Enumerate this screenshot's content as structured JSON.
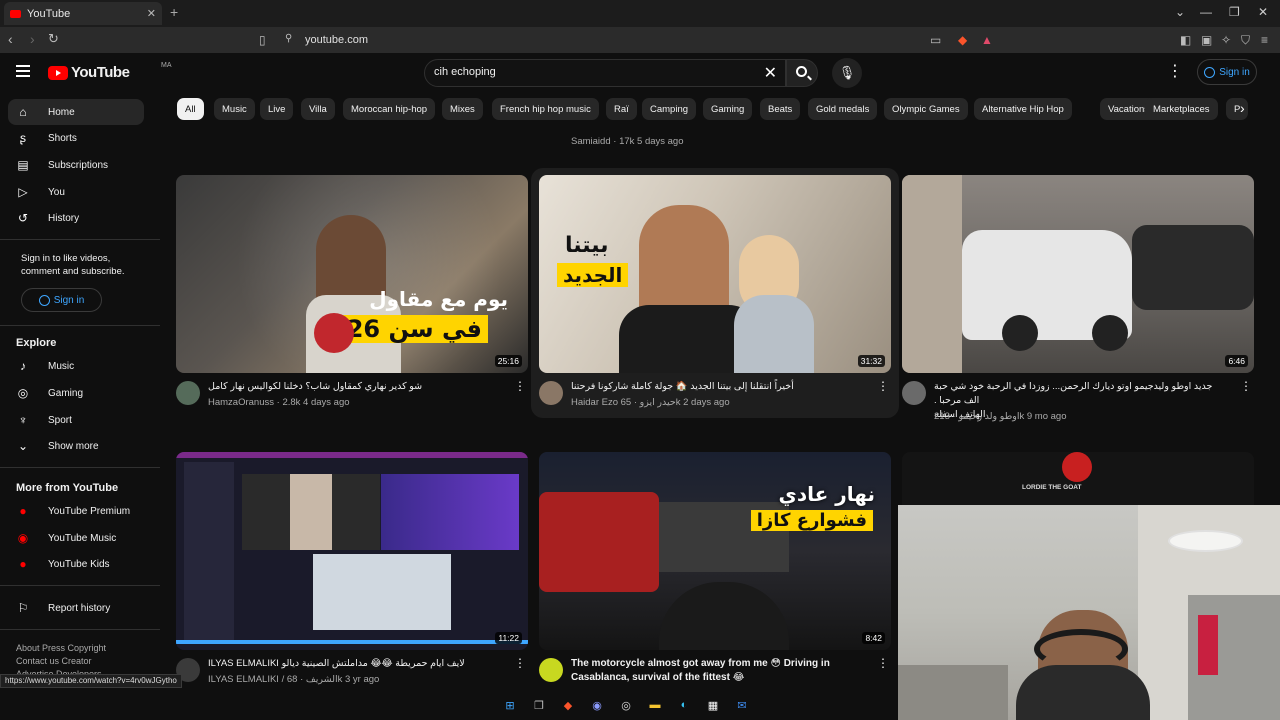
{
  "browser": {
    "tab_title": "YouTube",
    "url": "youtube.com",
    "status_url": "https://www.youtube.com/watch?v=4rv0wJGytho"
  },
  "header": {
    "logo_text": "YouTube",
    "region": "MA",
    "search_value": "cih echoping",
    "signin_label": "Sign in"
  },
  "sidebar": {
    "main": [
      "Home",
      "Shorts",
      "Subscriptions",
      "You",
      "History"
    ],
    "signin_prompt": "Sign in to like videos, comment and subscribe.",
    "signin_label": "Sign in",
    "explore_heading": "Explore",
    "explore": [
      "Music",
      "Gaming",
      "Sport",
      "Show more"
    ],
    "more_heading": "More from YouTube",
    "more": [
      "YouTube Premium",
      "YouTube Music",
      "YouTube Kids"
    ],
    "report": "Report history",
    "footer_line1": "About  Press  Copyright",
    "footer_line2": "Contact us  Creator",
    "footer_line3": "Advertise  Developers"
  },
  "chips": [
    "All",
    "Music",
    "Live",
    "Villa",
    "Moroccan hip-hop",
    "Mixes",
    "French hip hop music",
    "Raï",
    "Camping",
    "Gaming",
    "Beats",
    "Gold medals",
    "Olympic Games",
    "Alternative Hip Hop",
    "Vacations",
    "Marketplaces",
    "P"
  ],
  "top_row": {
    "middle_channel": "Samiaidd",
    "middle_meta": "17k  5 days ago"
  },
  "videos": [
    {
      "title": "شو كدير نهاري كمقاول شاب؟ دخلنا لكواليس نهار كامل",
      "channel": "HamzaOranuss",
      "meta": "2.8k  4 days ago",
      "duration": "25:16",
      "thumb_text1": "يوم مع مقاول",
      "thumb_text2": "في سن 26"
    },
    {
      "title": "أخيراً انتقلنا إلى بيتنا الجديد 🏠 جولة كاملة شاركونا فرحتنا",
      "channel": "Haidar Ezo  حيدر ايزو",
      "meta": "65k  2 days ago",
      "duration": "31:32",
      "thumb_text1": "بيتنا",
      "thumb_text2": "الجديد"
    },
    {
      "title": "جديد اوطو وليدجيمو اوتو ديارك الرحمن... زوزدا في الرحبة خود شي حبة الف مرحبا .",
      "title2": "الهاتف اسفله",
      "channel": "اوطو ولد رحيمو",
      "meta": "213k  9 mo ago",
      "duration": "6:46"
    },
    {
      "title": "ILYAS ELMALIKI  لايف ايام حمريطة 😂😂  مداملتش الصينية ديالو",
      "channel": "ILYAS ELMALIKI / الشريف",
      "meta": "68k  3 yr ago",
      "duration": "11:22"
    },
    {
      "title": "The motorcycle almost got away from me 😳 Driving in",
      "title2": "Casablanca, survival of the fittest 😂",
      "channel": "",
      "meta": "",
      "duration": "8:42",
      "thumb_text1": "نهار عادي",
      "thumb_text2": "فشوارع كازا"
    },
    {
      "thumb_text1": "LORDIE THE GOAT"
    }
  ],
  "colors": {
    "background": "#0f0f0f",
    "accent_blue": "#3ea6ff",
    "brand_red": "#ff0000",
    "chip_bg": "#272727"
  }
}
